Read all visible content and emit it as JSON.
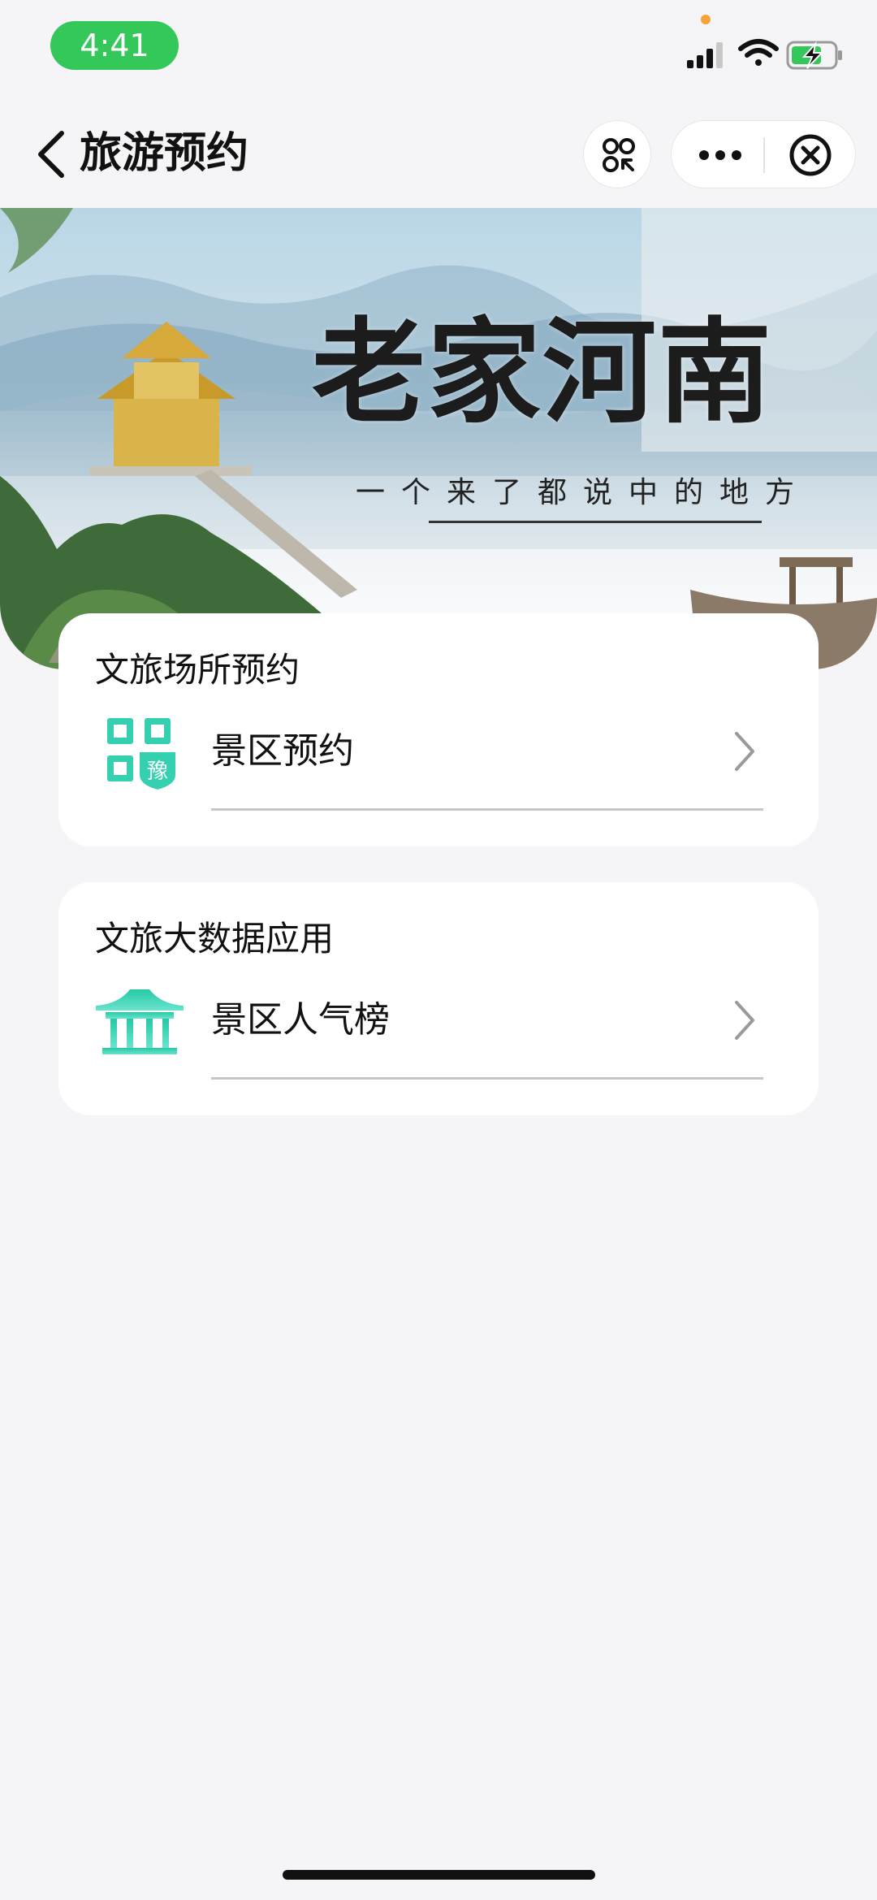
{
  "status_bar": {
    "time": "4:41",
    "icons": [
      "signal-icon",
      "wifi-icon",
      "battery-charging-icon"
    ],
    "pill_color": "#34c759"
  },
  "nav": {
    "title": "旅游预约",
    "icons": [
      "back-icon",
      "scan-icon",
      "more-icon",
      "close-icon"
    ]
  },
  "banner": {
    "title": "老家河南",
    "subtitle": "一个来了都说中的地方"
  },
  "sections": [
    {
      "title": "文旅场所预约",
      "items": [
        {
          "label": "景区预约",
          "icon": "qr-code-yu-icon"
        }
      ]
    },
    {
      "title": "文旅大数据应用",
      "items": [
        {
          "label": "景区人气榜",
          "icon": "pavilion-icon"
        }
      ]
    }
  ],
  "colors": {
    "accent": "#34d3b4",
    "background": "#f5f5f7"
  }
}
